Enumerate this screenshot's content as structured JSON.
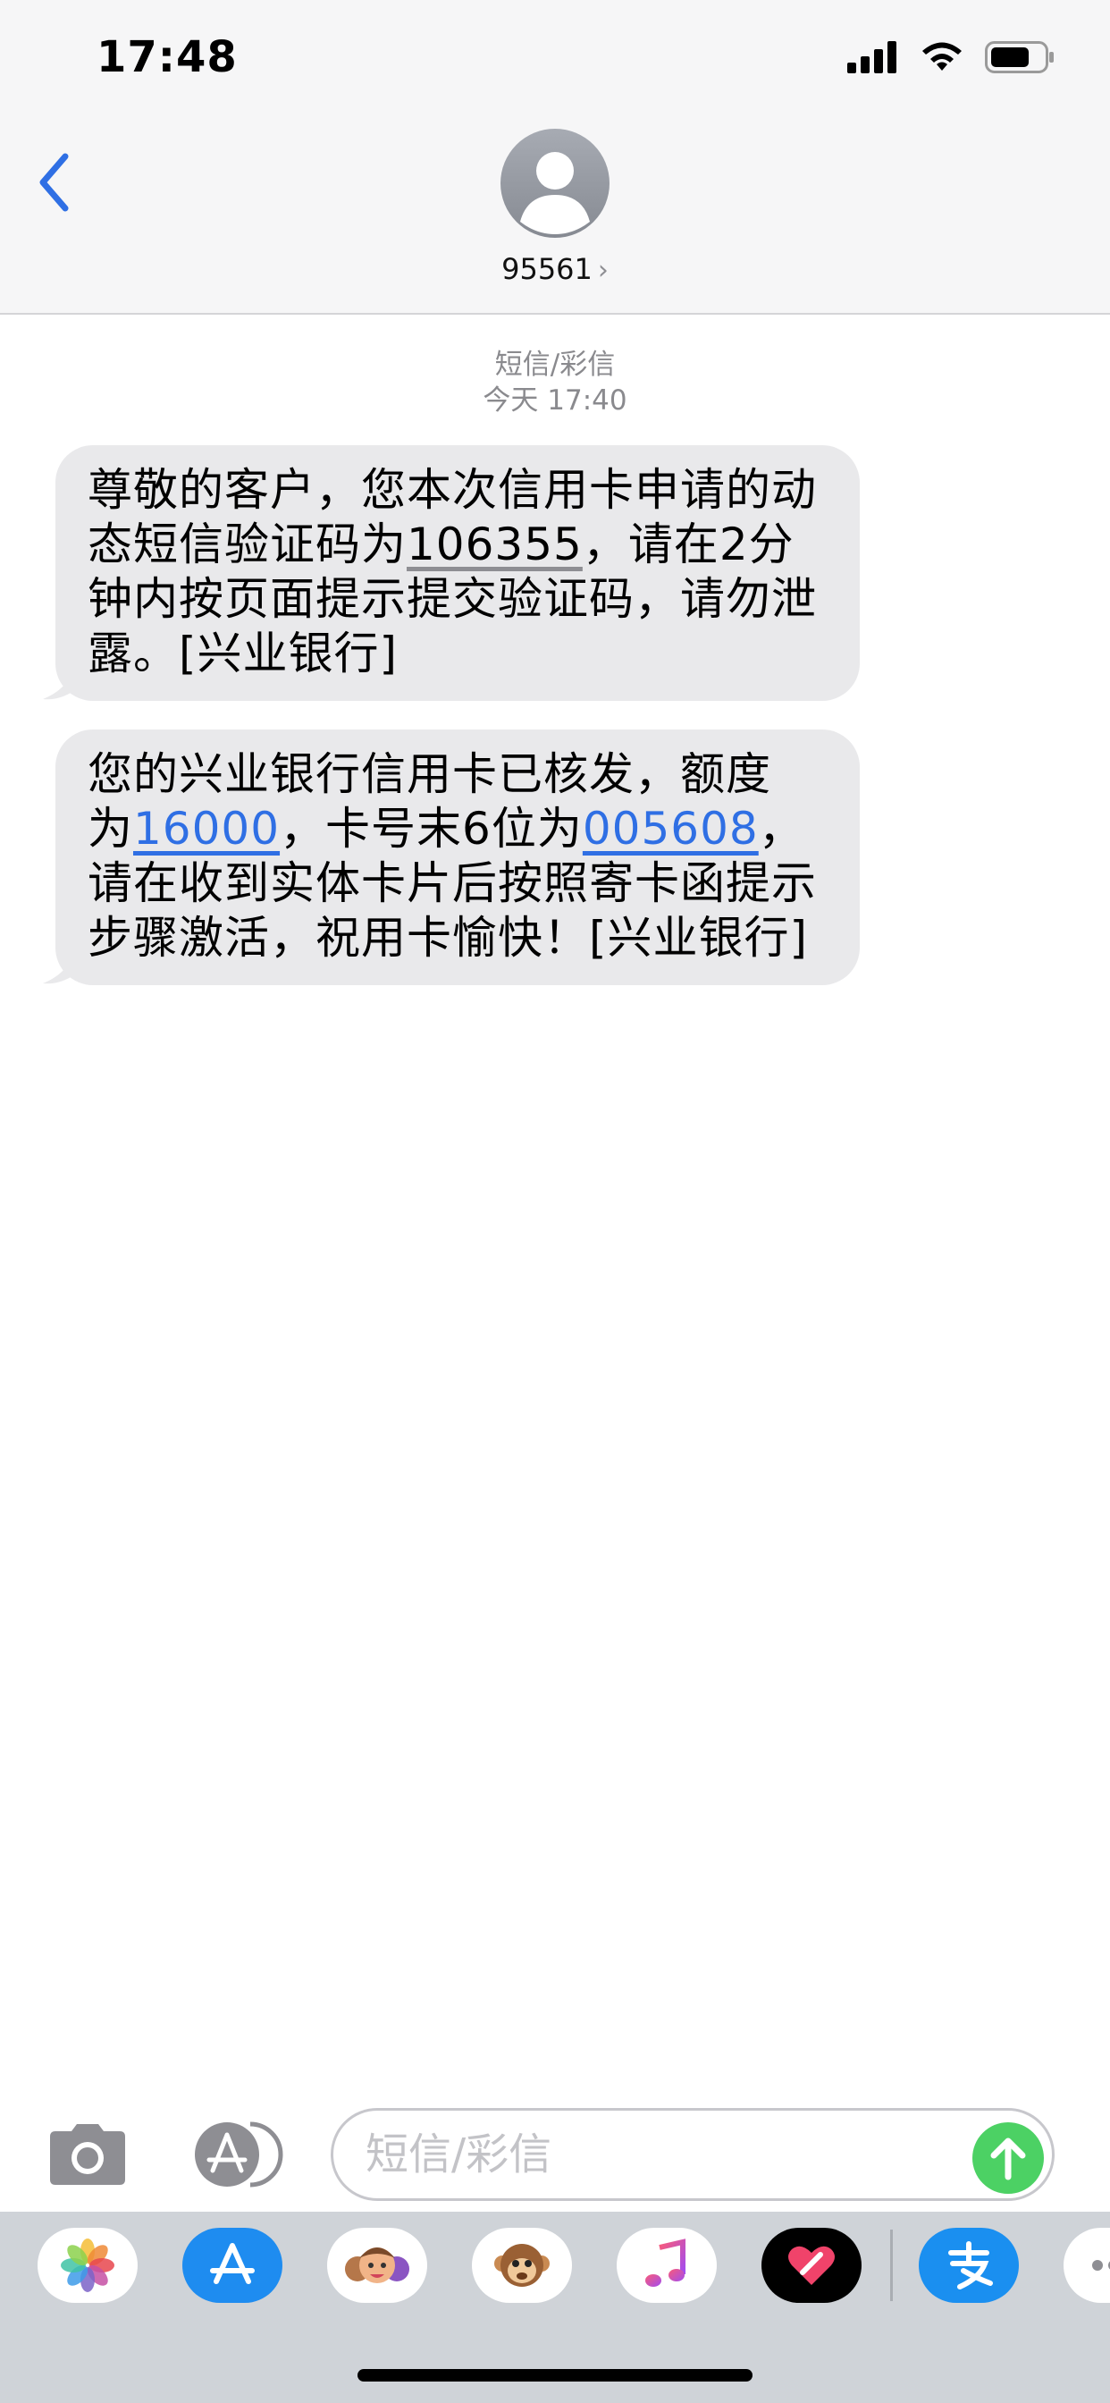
{
  "status": {
    "time": "17:48",
    "icons": [
      "signal-icon",
      "wifi-icon",
      "battery-icon"
    ]
  },
  "header": {
    "back_icon": "chevron-left-icon",
    "avatar_icon": "person-icon",
    "contact": "95561",
    "contact_chevron": "›"
  },
  "thread": {
    "service": "短信/彩信",
    "timestamp": "今天 17:40"
  },
  "messages": [
    {
      "line1": "尊敬的客户，您本次信用卡申请的动",
      "line2_before": "态短信验证码为",
      "line2_code": "106355",
      "line2_after": "，请在2分",
      "line3": "钟内按页面提示提交验证码，请勿泄",
      "line4": "露。[兴业银行]"
    },
    {
      "line1": "您的兴业银行信用卡已核发，额度",
      "line2_before": "为",
      "line2_amount": "16000",
      "line2_middle": "，卡号末6位为",
      "line2_card": "005608",
      "line2_after": "，",
      "line3": "请在收到实体卡片后按照寄卡函提示",
      "line4": "步骤激活，祝用卡愉快！[兴业银行]"
    }
  ],
  "composer": {
    "placeholder": "短信/彩信",
    "camera_icon": "camera-icon",
    "apps_icon": "app-store-icon",
    "send_icon": "arrow-up-icon"
  },
  "app_drawer": {
    "apps": [
      "photos-icon",
      "app-store-icon",
      "memoji-icon",
      "animoji-icon",
      "music-icon",
      "digital-touch-icon",
      "alipay-icon",
      "more-icon"
    ]
  },
  "colors": {
    "accent": "#2f6fe4",
    "send": "#4cd164",
    "bubble": "#e9e9eb",
    "header_bg": "#f6f6f7"
  }
}
